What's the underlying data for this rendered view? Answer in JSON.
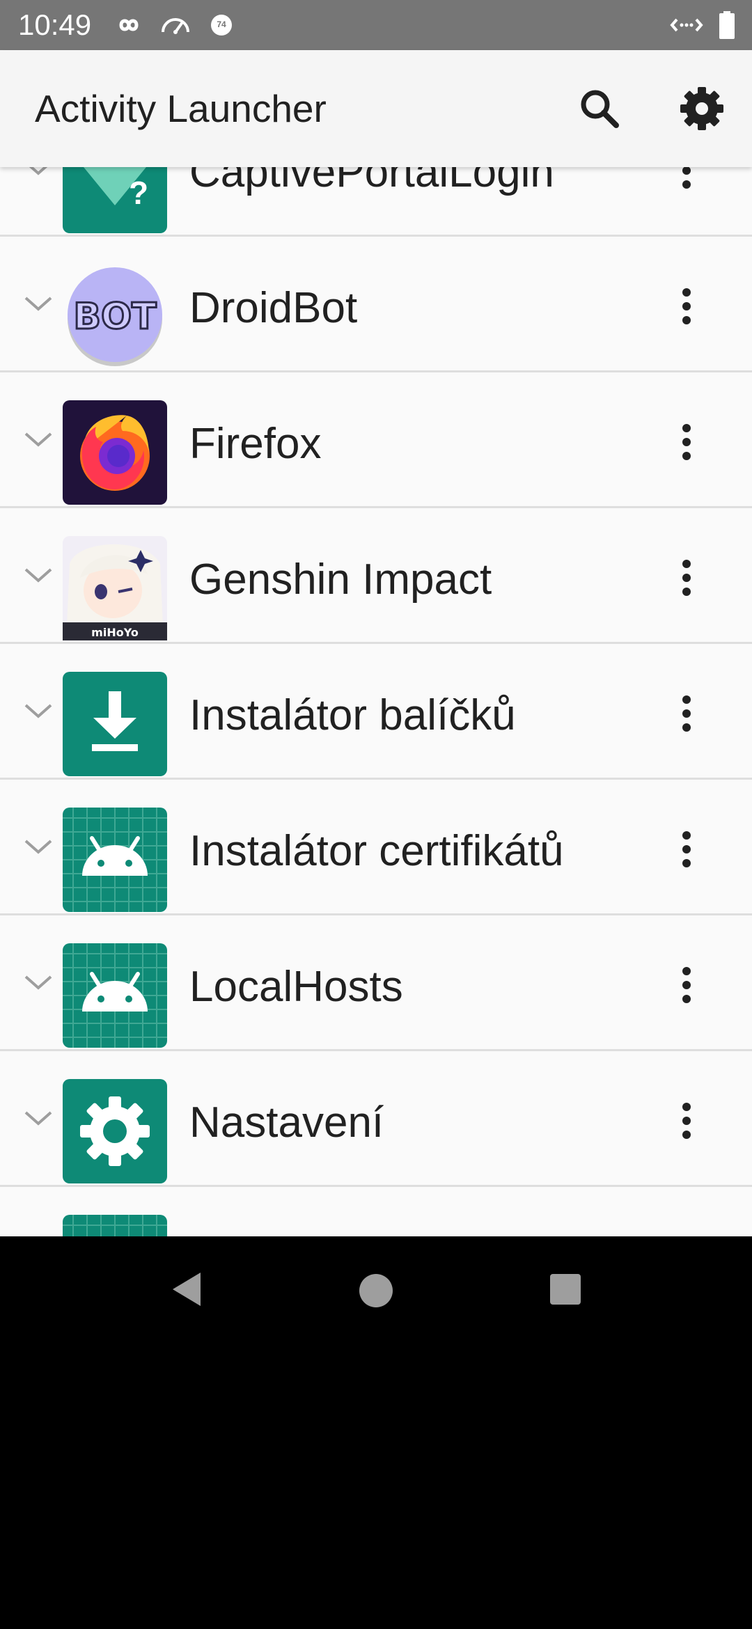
{
  "status_bar": {
    "time": "10:49",
    "icons_left": [
      "infinity-icon",
      "speedometer-icon",
      "notification-74-icon"
    ],
    "badge_number": "74",
    "icons_right": [
      "data-transfer-icon",
      "battery-icon"
    ]
  },
  "app_bar": {
    "title": "Activity Launcher",
    "actions": [
      "search-icon",
      "gear-icon"
    ]
  },
  "apps": [
    {
      "name": "CaptivePortalLogin",
      "icon": "captive-portal-icon"
    },
    {
      "name": "DroidBot",
      "icon": "droidbot-icon",
      "icon_text": "BOT"
    },
    {
      "name": "Firefox",
      "icon": "firefox-icon"
    },
    {
      "name": "Genshin Impact",
      "icon": "genshin-impact-icon",
      "icon_text": "miHoYo"
    },
    {
      "name": "Instalátor balíčků",
      "icon": "download-icon"
    },
    {
      "name": "Instalátor certifikátů",
      "icon": "android-icon"
    },
    {
      "name": "LocalHosts",
      "icon": "android-icon"
    },
    {
      "name": "Nastavení",
      "icon": "settings-icon"
    },
    {
      "name": "",
      "icon": "android-icon"
    }
  ],
  "nav_bar": {
    "buttons": [
      "back-icon",
      "home-icon",
      "recents-icon"
    ]
  },
  "colors": {
    "status_bar": "#767676",
    "app_bar": "#f5f5f5",
    "list_bg": "#fafafa",
    "teal_icon": "#0e8a76",
    "divider": "#dedede"
  }
}
